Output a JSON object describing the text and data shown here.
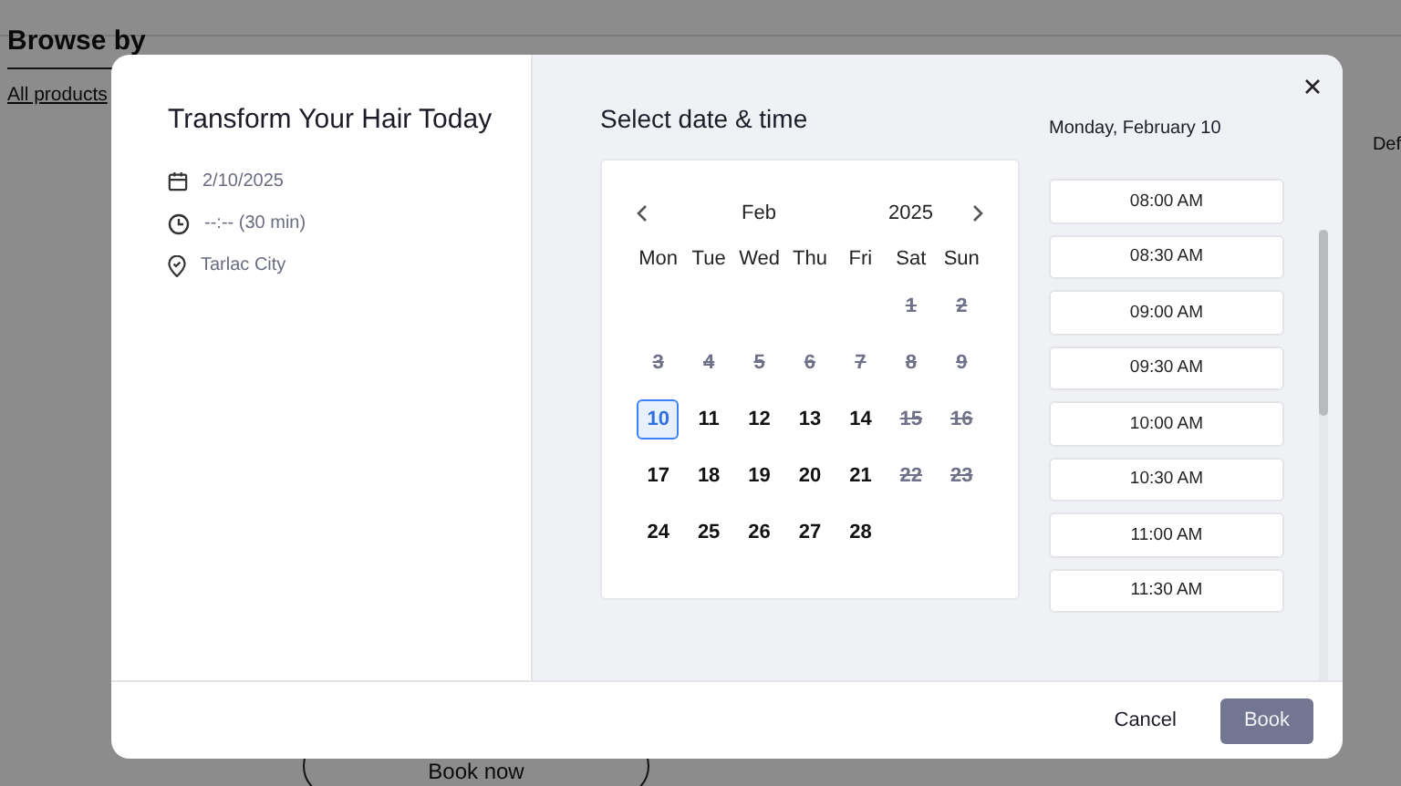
{
  "background_page": {
    "sidebar_title": "Browse by",
    "sidebar_link": "All products",
    "sort_label": "Def",
    "book_now_button": "Book now"
  },
  "dialog": {
    "title": "Transform Your Hair Today",
    "details": [
      {
        "kind": "date",
        "text": "2/10/2025"
      },
      {
        "kind": "time",
        "text": "--:-- (30 min)"
      },
      {
        "kind": "location",
        "text": "Tarlac City"
      }
    ],
    "section_title": "Select date & time",
    "calendar": {
      "month": "Feb",
      "year": "2025",
      "weekdays": [
        "Mon",
        "Tue",
        "Wed",
        "Thu",
        "Fri",
        "Sat",
        "Sun"
      ],
      "weeks": [
        [
          {
            "label": "1",
            "disabled": true,
            "selected": false
          },
          {
            "label": "2",
            "disabled": true,
            "selected": false
          }
        ],
        [
          {
            "label": "3",
            "disabled": true,
            "selected": false
          },
          {
            "label": "4",
            "disabled": true,
            "selected": false
          },
          {
            "label": "5",
            "disabled": true,
            "selected": false
          },
          {
            "label": "6",
            "disabled": true,
            "selected": false
          },
          {
            "label": "7",
            "disabled": true,
            "selected": false
          },
          {
            "label": "8",
            "disabled": true,
            "selected": false
          },
          {
            "label": "9",
            "disabled": true,
            "selected": false
          }
        ],
        [
          {
            "label": "10",
            "disabled": false,
            "selected": true
          },
          {
            "label": "11",
            "disabled": false,
            "selected": false
          },
          {
            "label": "12",
            "disabled": false,
            "selected": false
          },
          {
            "label": "13",
            "disabled": false,
            "selected": false
          },
          {
            "label": "14",
            "disabled": false,
            "selected": false
          },
          {
            "label": "15",
            "disabled": true,
            "selected": false
          },
          {
            "label": "16",
            "disabled": true,
            "selected": false
          }
        ],
        [
          {
            "label": "17",
            "disabled": false,
            "selected": false
          },
          {
            "label": "18",
            "disabled": false,
            "selected": false
          },
          {
            "label": "19",
            "disabled": false,
            "selected": false
          },
          {
            "label": "20",
            "disabled": false,
            "selected": false
          },
          {
            "label": "21",
            "disabled": false,
            "selected": false
          },
          {
            "label": "22",
            "disabled": true,
            "selected": false
          },
          {
            "label": "23",
            "disabled": true,
            "selected": false
          }
        ],
        [
          {
            "label": "24",
            "disabled": false,
            "selected": false
          },
          {
            "label": "25",
            "disabled": false,
            "selected": false
          },
          {
            "label": "26",
            "disabled": false,
            "selected": false
          },
          {
            "label": "27",
            "disabled": false,
            "selected": false
          },
          {
            "label": "28",
            "disabled": false,
            "selected": false
          }
        ]
      ]
    },
    "selected_day": "Monday, February 10",
    "time_slots": [
      "08:00 AM",
      "08:30 AM",
      "09:00 AM",
      "09:30 AM",
      "10:00 AM",
      "10:30 AM",
      "11:00 AM",
      "11:30 AM"
    ],
    "cancel_button": "Cancel",
    "book_button": {
      "label": "Book",
      "disabled": true
    }
  }
}
